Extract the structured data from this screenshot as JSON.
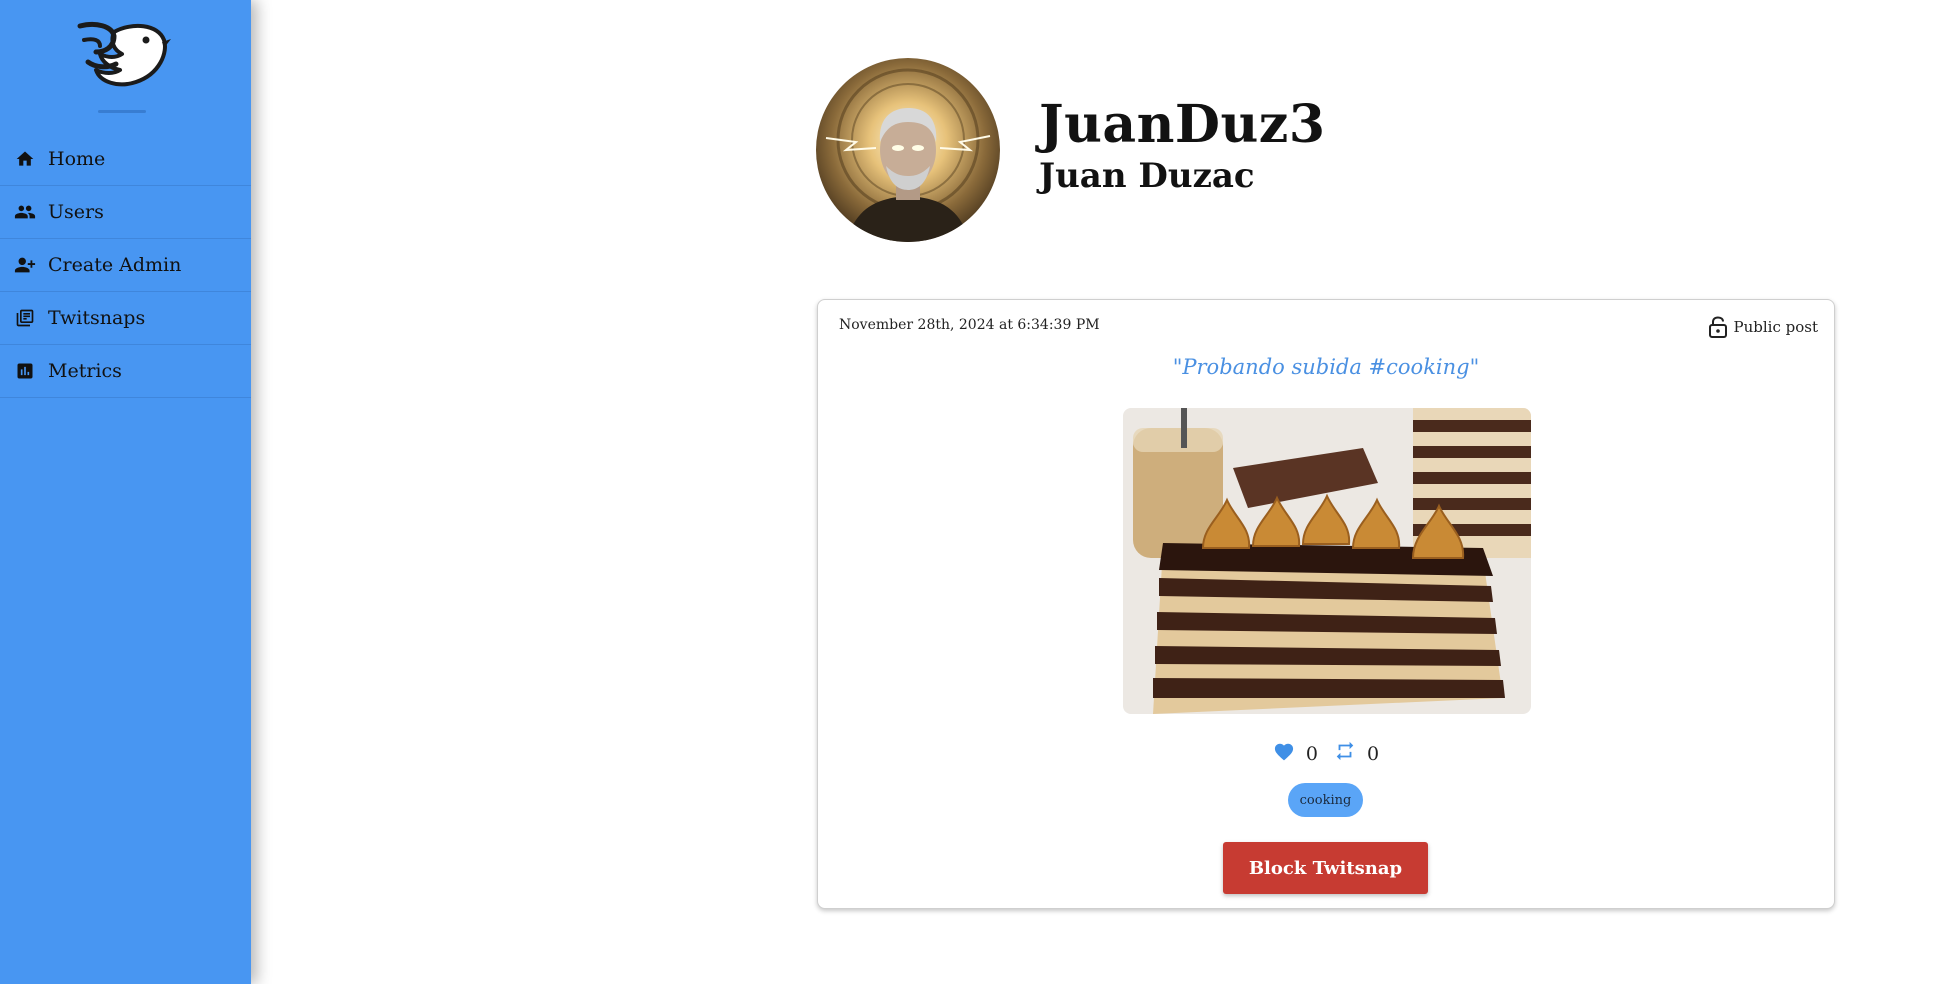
{
  "sidebar": {
    "logo_icon": "bird-logo-icon",
    "items": [
      {
        "label": "Home",
        "icon": "home-icon"
      },
      {
        "label": "Users",
        "icon": "users-icon"
      },
      {
        "label": "Create Admin",
        "icon": "person-add-icon"
      },
      {
        "label": "Twitsnaps",
        "icon": "library-icon"
      },
      {
        "label": "Metrics",
        "icon": "bar-chart-icon"
      }
    ]
  },
  "profile": {
    "username": "JuanDuz3",
    "full_name": "Juan Duzac"
  },
  "post": {
    "date": "November 28th, 2024 at 6:34:39 PM",
    "privacy_label": "Public post",
    "privacy_icon": "unlock-icon",
    "text": "\"Probando subida #cooking\"",
    "likes": "0",
    "retweets": "0",
    "tag": "cooking",
    "block_label": "Block Twitsnap"
  },
  "colors": {
    "sidebar_bg": "#4896f2",
    "accent": "#4a90e2",
    "tag_bg": "#5aa5f7",
    "danger": "#c73b32"
  }
}
